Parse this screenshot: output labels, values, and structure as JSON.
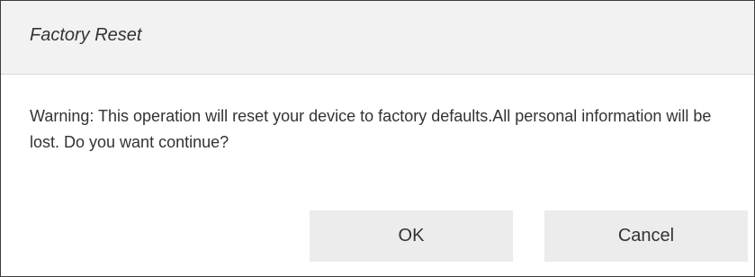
{
  "dialog": {
    "title": "Factory Reset",
    "message": "Warning: This operation will reset your device to factory defaults.All personal information will be lost. Do you want continue?",
    "ok_label": "OK",
    "cancel_label": "Cancel"
  },
  "colors": {
    "header_background": "#f2f2f2",
    "button_background": "#ececec",
    "text": "#333333",
    "border": "#3c3c3c"
  }
}
